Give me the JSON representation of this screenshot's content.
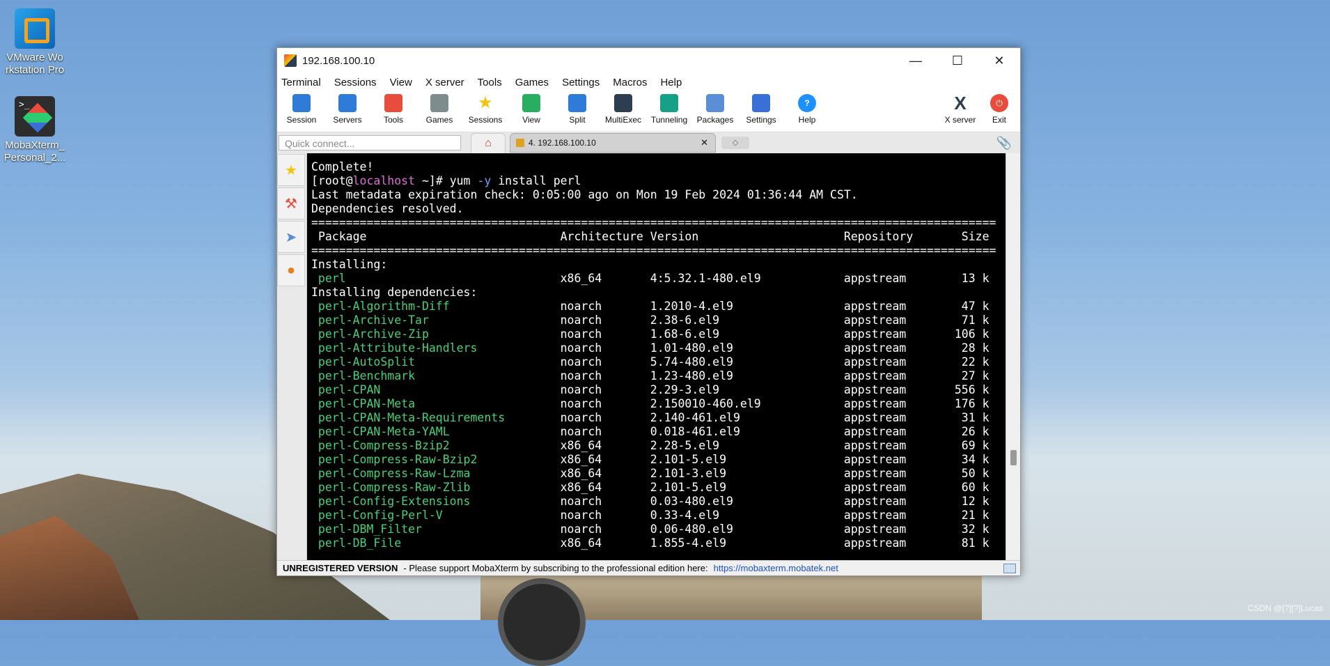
{
  "desktop": {
    "icons": [
      {
        "label": "VMware Wo rkstation Pro"
      },
      {
        "label": "MobaXterm_ Personal_2..."
      }
    ],
    "watermark": "CSDN @[?][?]Lucas"
  },
  "window": {
    "title": "192.168.100.10",
    "menu": [
      "Terminal",
      "Sessions",
      "View",
      "X server",
      "Tools",
      "Games",
      "Settings",
      "Macros",
      "Help"
    ],
    "toolbar": [
      "Session",
      "Servers",
      "Tools",
      "Games",
      "Sessions",
      "View",
      "Split",
      "MultiExec",
      "Tunneling",
      "Packages",
      "Settings",
      "Help"
    ],
    "toolbar_right": [
      "X server",
      "Exit"
    ],
    "quick_connect_placeholder": "Quick connect...",
    "tab_label": "4. 192.168.100.10"
  },
  "terminal": {
    "complete": "Complete!",
    "prompt_user": "[root@",
    "prompt_host": "localhost",
    "prompt_rest": " ~]# ",
    "command_main": "yum ",
    "command_flag": "-y",
    "command_args": " install perl",
    "line_metadata": "Last metadata expiration check: 0:05:00 ago on Mon 19 Feb 2024 01:36:44 AM CST.",
    "line_resolved": "Dependencies resolved.",
    "headers": [
      "Package",
      "Architecture",
      "Version",
      "Repository",
      "Size"
    ],
    "section_installing": "Installing:",
    "section_deps": "Installing dependencies:",
    "main_package": {
      "name": "perl",
      "arch": "x86_64",
      "version": "4:5.32.1-480.el9",
      "repo": "appstream",
      "size": "13 k"
    },
    "dependencies": [
      {
        "name": "perl-Algorithm-Diff",
        "arch": "noarch",
        "version": "1.2010-4.el9",
        "repo": "appstream",
        "size": "47 k"
      },
      {
        "name": "perl-Archive-Tar",
        "arch": "noarch",
        "version": "2.38-6.el9",
        "repo": "appstream",
        "size": "71 k"
      },
      {
        "name": "perl-Archive-Zip",
        "arch": "noarch",
        "version": "1.68-6.el9",
        "repo": "appstream",
        "size": "106 k"
      },
      {
        "name": "perl-Attribute-Handlers",
        "arch": "noarch",
        "version": "1.01-480.el9",
        "repo": "appstream",
        "size": "28 k"
      },
      {
        "name": "perl-AutoSplit",
        "arch": "noarch",
        "version": "5.74-480.el9",
        "repo": "appstream",
        "size": "22 k"
      },
      {
        "name": "perl-Benchmark",
        "arch": "noarch",
        "version": "1.23-480.el9",
        "repo": "appstream",
        "size": "27 k"
      },
      {
        "name": "perl-CPAN",
        "arch": "noarch",
        "version": "2.29-3.el9",
        "repo": "appstream",
        "size": "556 k"
      },
      {
        "name": "perl-CPAN-Meta",
        "arch": "noarch",
        "version": "2.150010-460.el9",
        "repo": "appstream",
        "size": "176 k"
      },
      {
        "name": "perl-CPAN-Meta-Requirements",
        "arch": "noarch",
        "version": "2.140-461.el9",
        "repo": "appstream",
        "size": "31 k"
      },
      {
        "name": "perl-CPAN-Meta-YAML",
        "arch": "noarch",
        "version": "0.018-461.el9",
        "repo": "appstream",
        "size": "26 k"
      },
      {
        "name": "perl-Compress-Bzip2",
        "arch": "x86_64",
        "version": "2.28-5.el9",
        "repo": "appstream",
        "size": "69 k"
      },
      {
        "name": "perl-Compress-Raw-Bzip2",
        "arch": "x86_64",
        "version": "2.101-5.el9",
        "repo": "appstream",
        "size": "34 k"
      },
      {
        "name": "perl-Compress-Raw-Lzma",
        "arch": "x86_64",
        "version": "2.101-3.el9",
        "repo": "appstream",
        "size": "50 k"
      },
      {
        "name": "perl-Compress-Raw-Zlib",
        "arch": "x86_64",
        "version": "2.101-5.el9",
        "repo": "appstream",
        "size": "60 k"
      },
      {
        "name": "perl-Config-Extensions",
        "arch": "noarch",
        "version": "0.03-480.el9",
        "repo": "appstream",
        "size": "12 k"
      },
      {
        "name": "perl-Config-Perl-V",
        "arch": "noarch",
        "version": "0.33-4.el9",
        "repo": "appstream",
        "size": "21 k"
      },
      {
        "name": "perl-DBM_Filter",
        "arch": "noarch",
        "version": "0.06-480.el9",
        "repo": "appstream",
        "size": "32 k"
      },
      {
        "name": "perl-DB_File",
        "arch": "x86_64",
        "version": "1.855-4.el9",
        "repo": "appstream",
        "size": "81 k"
      }
    ]
  },
  "statusbar": {
    "unregistered": "UNREGISTERED VERSION",
    "message": " -  Please support MobaXterm by subscribing to the professional edition here:",
    "link": "https://mobaxterm.mobatek.net"
  }
}
